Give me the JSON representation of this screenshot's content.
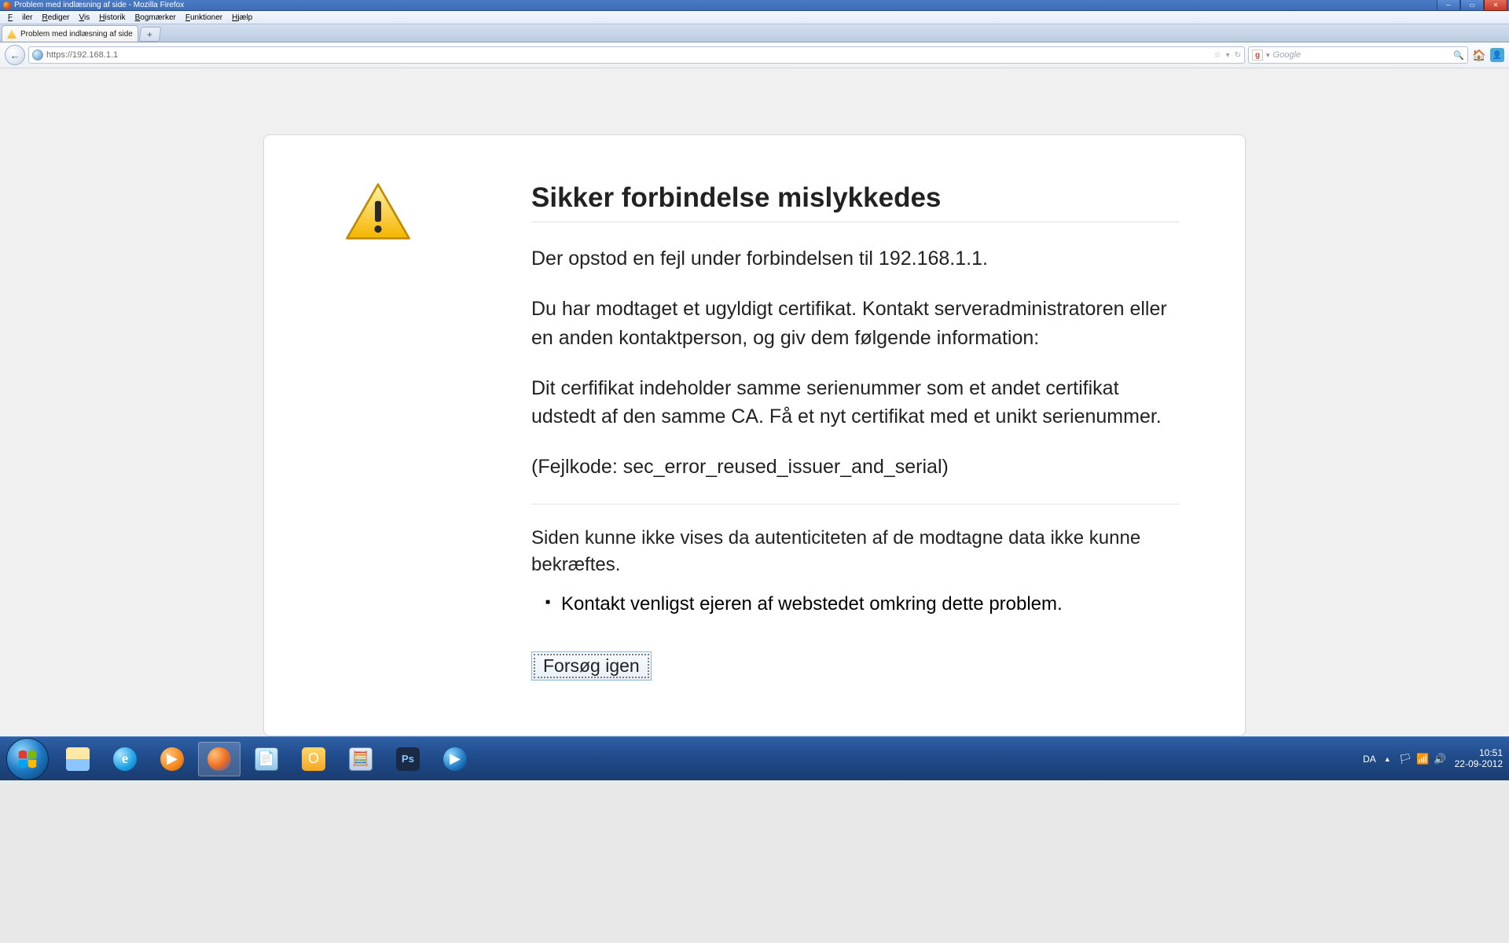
{
  "window": {
    "title": "Problem med indlæsning af side - Mozilla Firefox"
  },
  "menu": {
    "items": [
      "Filer",
      "Rediger",
      "Vis",
      "Historik",
      "Bogmærker",
      "Funktioner",
      "Hjælp"
    ]
  },
  "tab": {
    "title": "Problem med indlæsning af side"
  },
  "url": {
    "value": "https://192.168.1.1"
  },
  "search": {
    "placeholder": "Google"
  },
  "error": {
    "heading": "Sikker forbindelse mislykkedes",
    "p1": "Der opstod en fejl under forbindelsen til 192.168.1.1.",
    "p2": "Du har modtaget et ugyldigt certifikat. Kontakt serveradministratoren eller en anden kontaktperson, og giv dem følgende information:",
    "p3": "Dit cerfifikat indeholder samme serienummer som et andet certifikat udstedt af den samme CA. Få et nyt certifikat med et unikt serienummer.",
    "p4": "(Fejlkode: sec_error_reused_issuer_and_serial)",
    "aux": "Siden kunne ikke vises da autenticiteten af de modtagne data ikke kunne bekræftes.",
    "bullet": "Kontakt venligst ejeren af webstedet omkring dette problem.",
    "retry": "Forsøg igen"
  },
  "tray": {
    "lang": "DA",
    "time": "10:51",
    "date": "22-09-2012"
  }
}
